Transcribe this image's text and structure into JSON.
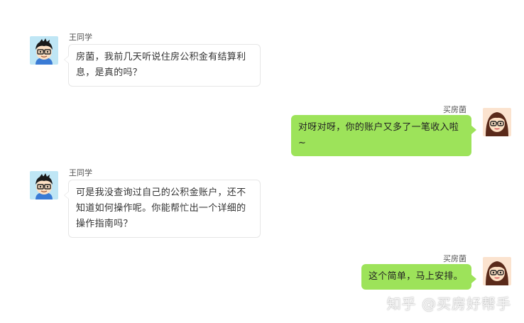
{
  "conversation": {
    "messages": [
      {
        "sender": "王同学",
        "side": "left",
        "avatar_icon": "boy-avatar-icon",
        "text": "房菌，我前几天听说住房公积金有结算利息，是真的吗？"
      },
      {
        "sender": "买房菌",
        "side": "right",
        "avatar_icon": "girl-avatar-icon",
        "text": "对呀对呀，你的账户又多了一笔收入啦~"
      },
      {
        "sender": "王同学",
        "side": "left",
        "avatar_icon": "boy-avatar-icon",
        "text": "可是我没查询过自己的公积金账户，还不知道如何操作呢。你能帮忙出一个详细的操作指南吗？"
      },
      {
        "sender": "买房菌",
        "side": "right",
        "avatar_icon": "girl-avatar-icon",
        "text": "这个简单，马上安排。"
      }
    ]
  },
  "watermark": {
    "text": "知乎 @买房好帮手"
  },
  "colors": {
    "left_bubble_bg": "#ffffff",
    "left_bubble_border": "#e6e6e6",
    "right_bubble_bg": "#9de35a",
    "text": "#333333"
  }
}
